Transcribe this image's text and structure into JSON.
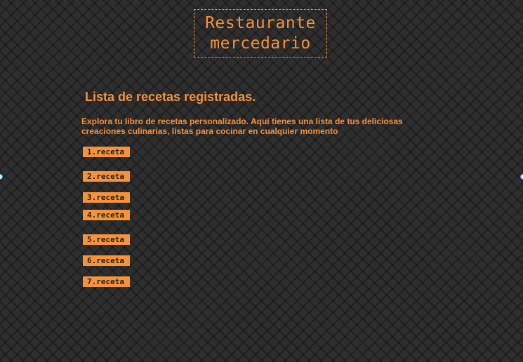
{
  "header": {
    "logo_line1": "Restaurante",
    "logo_line2": "mercedario"
  },
  "main": {
    "title": "Lista de recetas registradas.",
    "intro": "Explora tu libro de recetas personalizado. Aquí tienes una lista de tus deliciosas creaciones culinarias, listas para cocinar en cualquier momento"
  },
  "recipes": [
    {
      "label": "1.receta"
    },
    {
      "label": "2.receta"
    },
    {
      "label": "3.receta"
    },
    {
      "label": "4.receta"
    },
    {
      "label": "5.receta"
    },
    {
      "label": "6.receta"
    },
    {
      "label": "7.receta"
    }
  ],
  "colors": {
    "accent": "#f5923a",
    "background": "#2e2e2e",
    "button_text": "#1e1e1e"
  }
}
